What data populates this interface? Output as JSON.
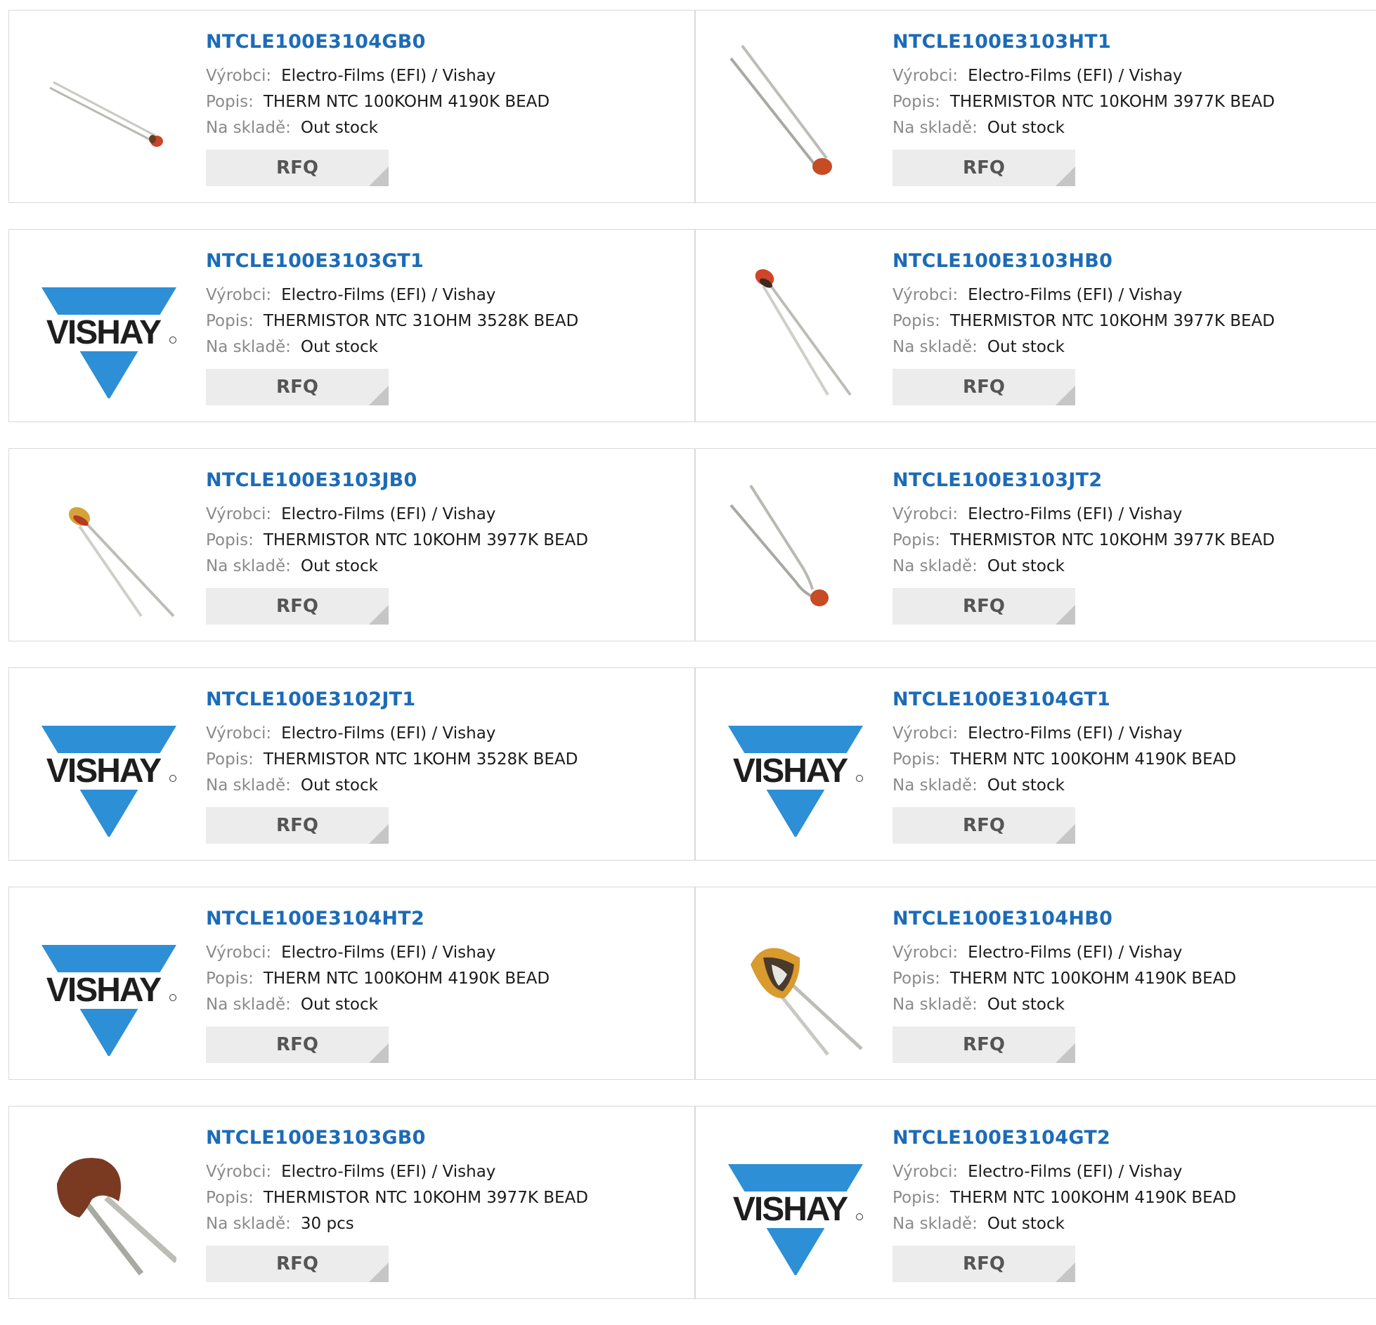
{
  "labels": {
    "manufacturer": "Výrobci:",
    "description": "Popis:",
    "stock": "Na skladě:",
    "rfq": "RFQ"
  },
  "logo_text": "VISHAY",
  "products": [
    {
      "part": "NTCLE100E3104GB0",
      "manufacturer": "Electro-Films (EFI) / Vishay",
      "description": "THERM NTC 100KOHM 4190K BEAD",
      "stock": "Out stock",
      "image": "bead-thermistor-photo"
    },
    {
      "part": "NTCLE100E3103HT1",
      "manufacturer": "Electro-Films (EFI) / Vishay",
      "description": "THERMISTOR NTC 10KOHM 3977K BEAD",
      "stock": "Out stock",
      "image": "bead-thermistor-photo"
    },
    {
      "part": "NTCLE100E3103GT1",
      "manufacturer": "Electro-Films (EFI) / Vishay",
      "description": "THERMISTOR NTC 31OHM 3528K BEAD",
      "stock": "Out stock",
      "image": "vishay-logo"
    },
    {
      "part": "NTCLE100E3103HB0",
      "manufacturer": "Electro-Films (EFI) / Vishay",
      "description": "THERMISTOR NTC 10KOHM 3977K BEAD",
      "stock": "Out stock",
      "image": "bead-thermistor-photo"
    },
    {
      "part": "NTCLE100E3103JB0",
      "manufacturer": "Electro-Films (EFI) / Vishay",
      "description": "THERMISTOR NTC 10KOHM 3977K BEAD",
      "stock": "Out stock",
      "image": "bead-thermistor-photo"
    },
    {
      "part": "NTCLE100E3103JT2",
      "manufacturer": "Electro-Films (EFI) / Vishay",
      "description": "THERMISTOR NTC 10KOHM 3977K BEAD",
      "stock": "Out stock",
      "image": "bead-thermistor-photo"
    },
    {
      "part": "NTCLE100E3102JT1",
      "manufacturer": "Electro-Films (EFI) / Vishay",
      "description": "THERMISTOR NTC 1KOHM 3528K BEAD",
      "stock": "Out stock",
      "image": "vishay-logo"
    },
    {
      "part": "NTCLE100E3104GT1",
      "manufacturer": "Electro-Films (EFI) / Vishay",
      "description": "THERM NTC 100KOHM 4190K BEAD",
      "stock": "Out stock",
      "image": "vishay-logo"
    },
    {
      "part": "NTCLE100E3104HT2",
      "manufacturer": "Electro-Films (EFI) / Vishay",
      "description": "THERM NTC 100KOHM 4190K BEAD",
      "stock": "Out stock",
      "image": "vishay-logo"
    },
    {
      "part": "NTCLE100E3104HB0",
      "manufacturer": "Electro-Films (EFI) / Vishay",
      "description": "THERM NTC 100KOHM 4190K BEAD",
      "stock": "Out stock",
      "image": "bead-thermistor-photo"
    },
    {
      "part": "NTCLE100E3103GB0",
      "manufacturer": "Electro-Films (EFI) / Vishay",
      "description": "THERMISTOR NTC 10KOHM 3977K BEAD",
      "stock": "30 pcs",
      "image": "bead-thermistor-photo"
    },
    {
      "part": "NTCLE100E3104GT2",
      "manufacturer": "Electro-Films (EFI) / Vishay",
      "description": "THERM NTC 100KOHM 4190K BEAD",
      "stock": "Out stock",
      "image": "vishay-logo"
    }
  ],
  "colors": {
    "link": "#1c6bb7",
    "logo_blue": "#2d8fd5",
    "button_bg": "#ececec"
  }
}
